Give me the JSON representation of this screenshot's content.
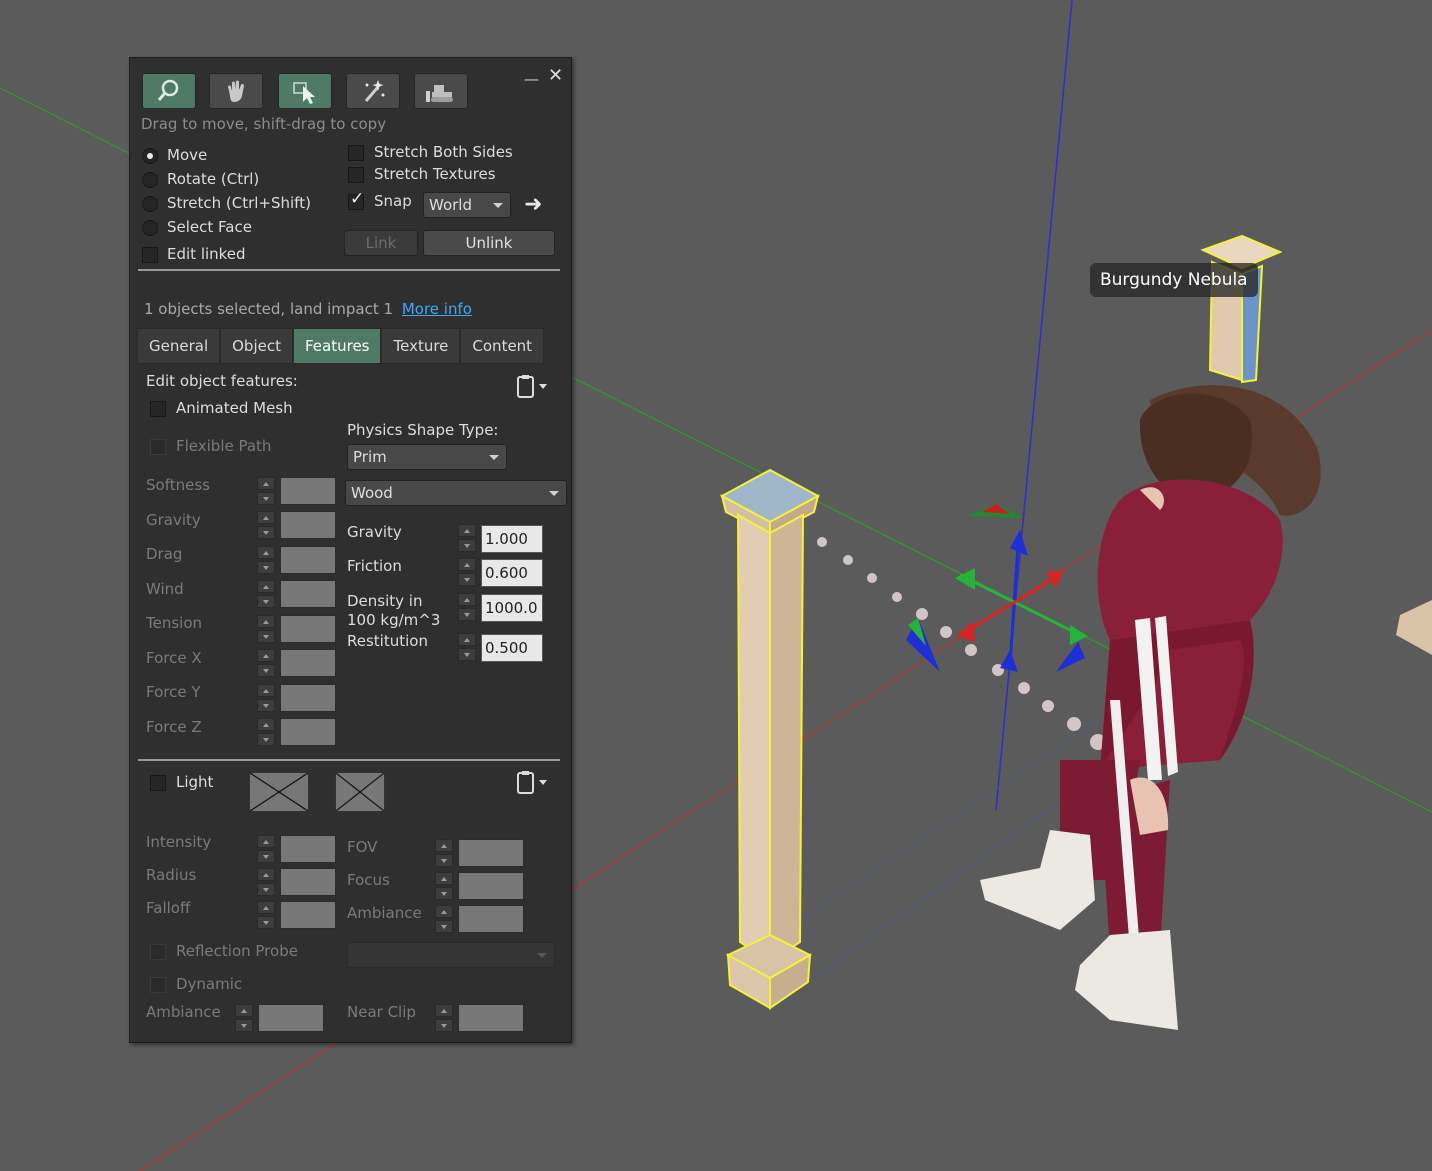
{
  "toolbar": {
    "tools": [
      {
        "name": "focus-tool",
        "icon": "magnifier-icon",
        "active": true
      },
      {
        "name": "move-tool",
        "icon": "grab-hand-icon",
        "active": false
      },
      {
        "name": "edit-tool",
        "icon": "arrow-cursor-icon",
        "active": true
      },
      {
        "name": "create-tool",
        "icon": "magic-wand-icon",
        "active": false
      },
      {
        "name": "land-tool",
        "icon": "bulldozer-icon",
        "active": false
      }
    ],
    "minimize_icon": "minimize-icon",
    "close_icon": "close-icon"
  },
  "hint": "Drag to move, shift-drag to copy",
  "modes": {
    "move": "Move",
    "rotate": "Rotate (Ctrl)",
    "stretch": "Stretch (Ctrl+Shift)",
    "select_face": "Select Face",
    "selected": "Move"
  },
  "edit_linked": "Edit linked",
  "stretch_both_sides": "Stretch Both Sides",
  "stretch_textures": "Stretch Textures",
  "snap": {
    "label": "Snap",
    "checked": true,
    "grid": "World"
  },
  "link_label": "Link",
  "unlink_label": "Unlink",
  "selection_info": "1 objects selected, land impact 1",
  "more_info": "More info",
  "tabs": [
    "General",
    "Object",
    "Features",
    "Texture",
    "Content"
  ],
  "active_tab": "Features",
  "features": {
    "heading": "Edit object features:",
    "animated_mesh": "Animated Mesh",
    "flexible_path": "Flexible Path",
    "flex_labels": {
      "softness": "Softness",
      "gravity": "Gravity",
      "drag": "Drag",
      "wind": "Wind",
      "tension": "Tension",
      "force_x": "Force X",
      "force_y": "Force Y",
      "force_z": "Force Z"
    },
    "physics_shape_label": "Physics Shape Type:",
    "physics_shape": "Prim",
    "material": "Wood",
    "physics": {
      "gravity_label": "Gravity",
      "gravity": "1.000",
      "friction_label": "Friction",
      "friction": "0.600",
      "density_label_1": "Density in",
      "density_label_2": "100 kg/m^3",
      "density": "1000.0",
      "restitution_label": "Restitution",
      "restitution": "0.500"
    }
  },
  "light": {
    "label": "Light",
    "intensity": "Intensity",
    "radius": "Radius",
    "falloff": "Falloff",
    "fov": "FOV",
    "focus": "Focus",
    "ambiance": "Ambiance"
  },
  "reflection": {
    "probe": "Reflection Probe",
    "dynamic": "Dynamic",
    "ambiance": "Ambiance",
    "near_clip": "Near Clip"
  },
  "avatar_name": "Burgundy Nebula",
  "colors": {
    "panel_bg": "#2f2f2f",
    "active_green": "#4e7a66",
    "link_blue": "#3fa9f5",
    "viewport_bg": "#5b5b5b",
    "selection_yellow": "#f5f03c"
  }
}
